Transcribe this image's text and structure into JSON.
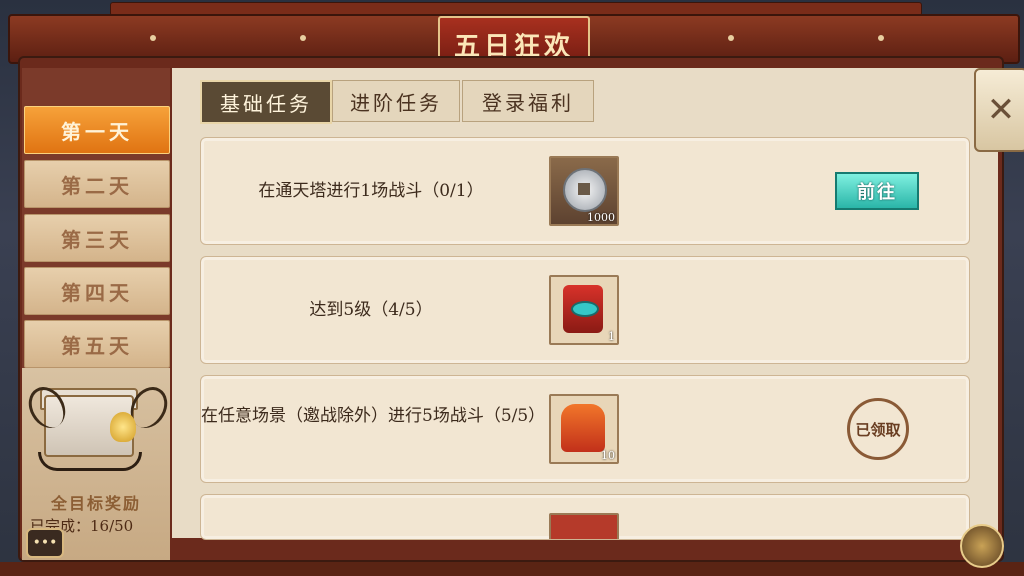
{
  "title": "五日狂欢",
  "days": [
    {
      "label": "第一天",
      "active": true
    },
    {
      "label": "第二天",
      "active": false
    },
    {
      "label": "第三天",
      "active": false
    },
    {
      "label": "第四天",
      "active": false
    },
    {
      "label": "第五天",
      "active": false
    }
  ],
  "reward": {
    "title": "全目标奖励",
    "progress": "已完成：16/50"
  },
  "tabs": [
    {
      "label": "基础任务",
      "active": true
    },
    {
      "label": "进阶任务",
      "active": false
    },
    {
      "label": "登录福利",
      "active": false
    }
  ],
  "tasks": [
    {
      "text": "在通天塔进行1场战斗（0/1）",
      "item_icon": "silver-coin-icon",
      "count": "1000",
      "action": "前往",
      "status": "goto"
    },
    {
      "text": "达到5级（4/5）",
      "item_icon": "red-pouch-icon",
      "count": "1",
      "action": "",
      "status": "none"
    },
    {
      "text": "在任意场景（邀战除外）进行5场战斗（5/5）",
      "item_icon": "orange-pouch-icon",
      "count": "10",
      "action": "已领取",
      "status": "claimed"
    }
  ],
  "icons": {
    "close": "close-icon",
    "chat": "chat-icon",
    "corner": "menu-emblem-icon"
  },
  "colors": {
    "active_day": "#e07412",
    "goto_button": "#2ab5a8",
    "frame": "#6b2a1c"
  }
}
